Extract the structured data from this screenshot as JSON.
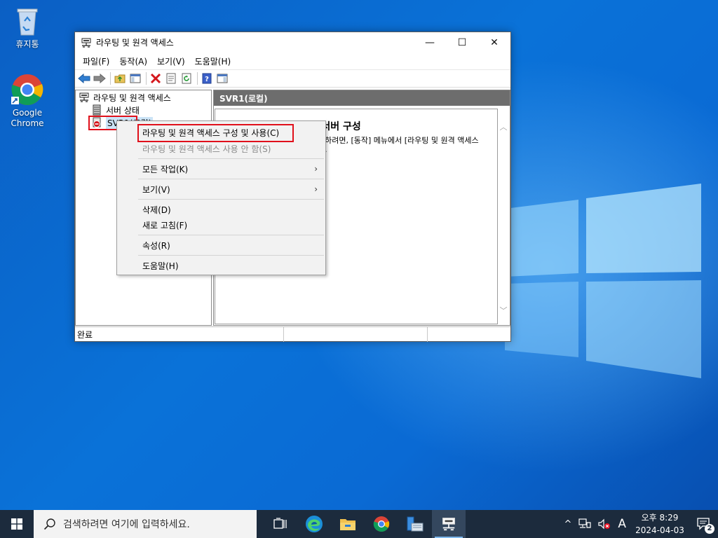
{
  "desktop": {
    "icons": [
      {
        "label": "휴지통"
      },
      {
        "label": "Google\nChrome"
      }
    ]
  },
  "window": {
    "title": "라우팅 및 원격 액세스",
    "controls": {
      "minimize": "—",
      "maximize": "☐",
      "close": "✕"
    },
    "menu": [
      "파일(F)",
      "동작(A)",
      "보기(V)",
      "도움말(H)"
    ],
    "tree": {
      "root": "라우팅 및 원격 액세스",
      "server_status": "서버 상태",
      "server": "SVR1(로컬)"
    },
    "right_pane": {
      "header": "SVR1(로컬)",
      "title": "라우팅 및 원격 액세스 서버 구성",
      "text": "지하려면, [동작] 메뉴에서 [라우팅 및 원격 액세스\n오."
    },
    "status": "완료"
  },
  "context_menu": {
    "items": [
      {
        "label": "라우팅 및 원격 액세스 구성 및 사용(C)",
        "enabled": true
      },
      {
        "label": "라우팅 및 원격 액세스 사용 안 함(S)",
        "enabled": false
      },
      {
        "label": "모든 작업(K)",
        "enabled": true,
        "submenu": "›"
      },
      {
        "label": "보기(V)",
        "enabled": true,
        "submenu": "›"
      },
      {
        "label": "삭제(D)",
        "enabled": true
      },
      {
        "label": "새로 고침(F)",
        "enabled": true
      },
      {
        "label": "속성(R)",
        "enabled": true
      },
      {
        "label": "도움말(H)",
        "enabled": true
      }
    ]
  },
  "taskbar": {
    "search_placeholder": "검색하려면 여기에 입력하세요.",
    "tray": {
      "chevron": "^",
      "ime": "A",
      "time": "오후 8:29",
      "date": "2024-04-03",
      "notifications": "2"
    }
  },
  "colors": {
    "highlight_box": "#e0101b",
    "pane_header": "#6d6d6d",
    "taskbar": "#1c2b3d"
  }
}
